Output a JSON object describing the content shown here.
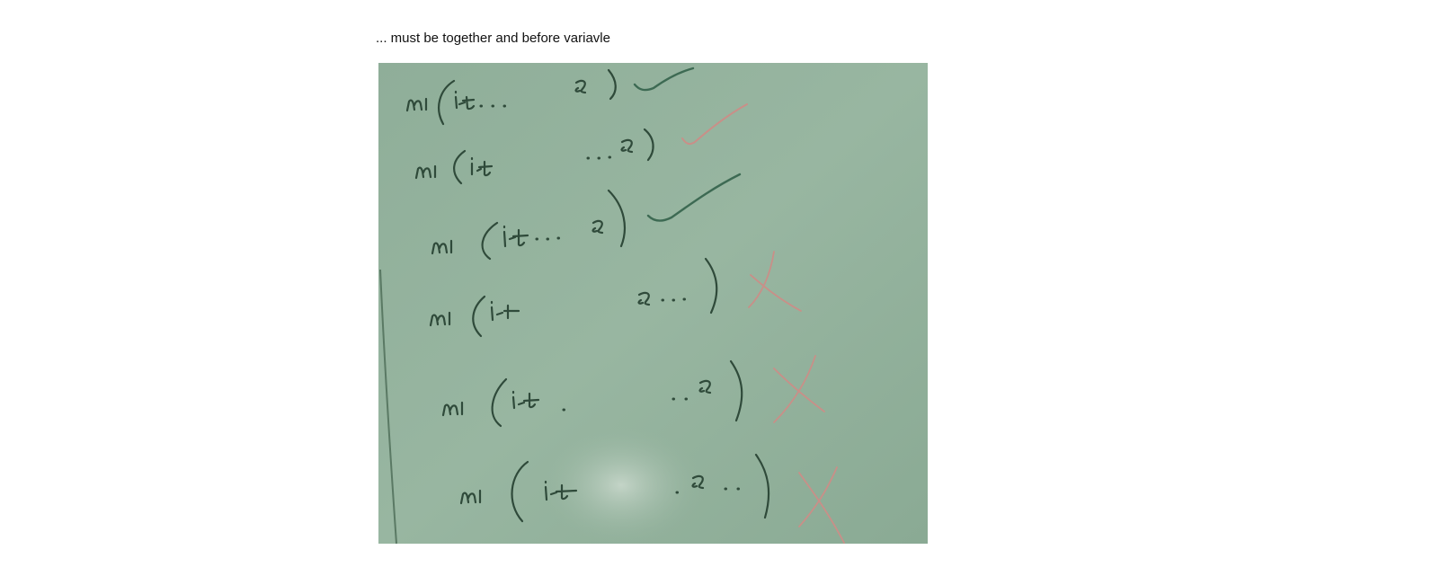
{
  "caption": "... must be together and before variavle",
  "board": {
    "background_color": "#93b19c",
    "ink_color": "#2f4a3a",
    "check_color_green": "#3d6a53",
    "check_color_red": "#c98f88",
    "lines": [
      {
        "left": "m1(i-t...",
        "right": "x)",
        "mark": "check",
        "mark_color": "green"
      },
      {
        "left": "m1(i-t",
        "right": "...x)",
        "mark": "check",
        "mark_color": "red"
      },
      {
        "left": "m1(i-t...x)",
        "right": "",
        "mark": "check",
        "mark_color": "green"
      },
      {
        "left": "m1(i-t",
        "right": "x...)",
        "mark": "cross",
        "mark_color": "red"
      },
      {
        "left": "m1(i-t.",
        "right": "..x)",
        "mark": "cross",
        "mark_color": "red"
      },
      {
        "left": "m1(i-t",
        "right": ".x..)",
        "mark": "cross",
        "mark_color": "red"
      }
    ]
  }
}
